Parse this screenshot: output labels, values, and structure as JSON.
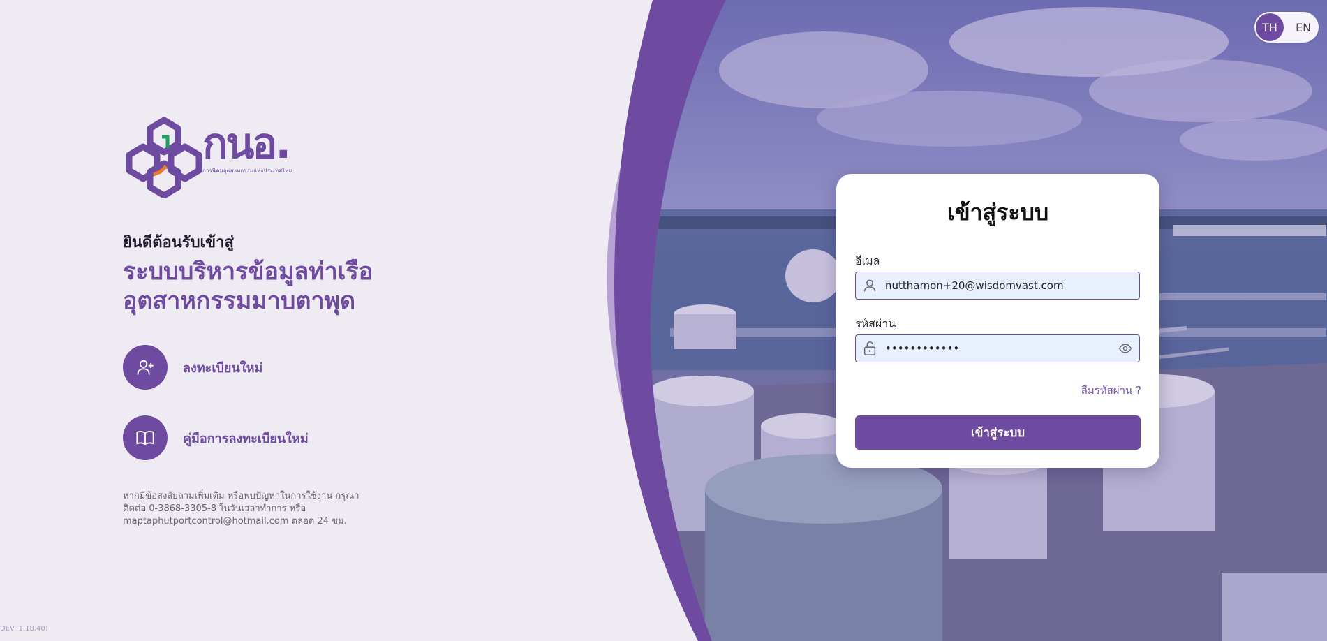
{
  "brand": {
    "logo_text": "กนอ.",
    "logo_subtitle": "การนิคมอุตสาหกรรมแห่งประเทศไทย",
    "primary_color": "#6e4aa0"
  },
  "welcome": {
    "greeting": "ยินดีต้อนรับเข้าสู่",
    "system_title": "ระบบบริหารข้อมูลท่าเรืออุตสาหกรรมมาบตาพุด"
  },
  "actions": [
    {
      "label": "ลงทะเบียนใหม่",
      "icon": "user-plus-icon"
    },
    {
      "label": "คู่มือการลงทะเบียนใหม่",
      "icon": "book-icon"
    }
  ],
  "contact": {
    "text": "หากมีข้อสงสัยถามเพิ่มเติม หรือพบปัญหาในการใช้งาน กรุณาติดต่อ 0-3868-3305-8 ในวันเวลาทำการ หรือ maptaphutportcontrol@hotmail.com ตลอด 24 ชม."
  },
  "version": "DEV: 1.18.40)",
  "language": {
    "options": [
      "TH",
      "EN"
    ],
    "selected": "TH"
  },
  "login": {
    "title": "เข้าสู่ระบบ",
    "email_label": "อีเมล",
    "email_value": "nutthamon+20@wisdomvast.com",
    "password_label": "รหัสผ่าน",
    "password_value": "••••••••••••",
    "forgot_label": "ลืมรหัสผ่าน ?",
    "submit_label": "เข้าสู่ระบบ"
  }
}
